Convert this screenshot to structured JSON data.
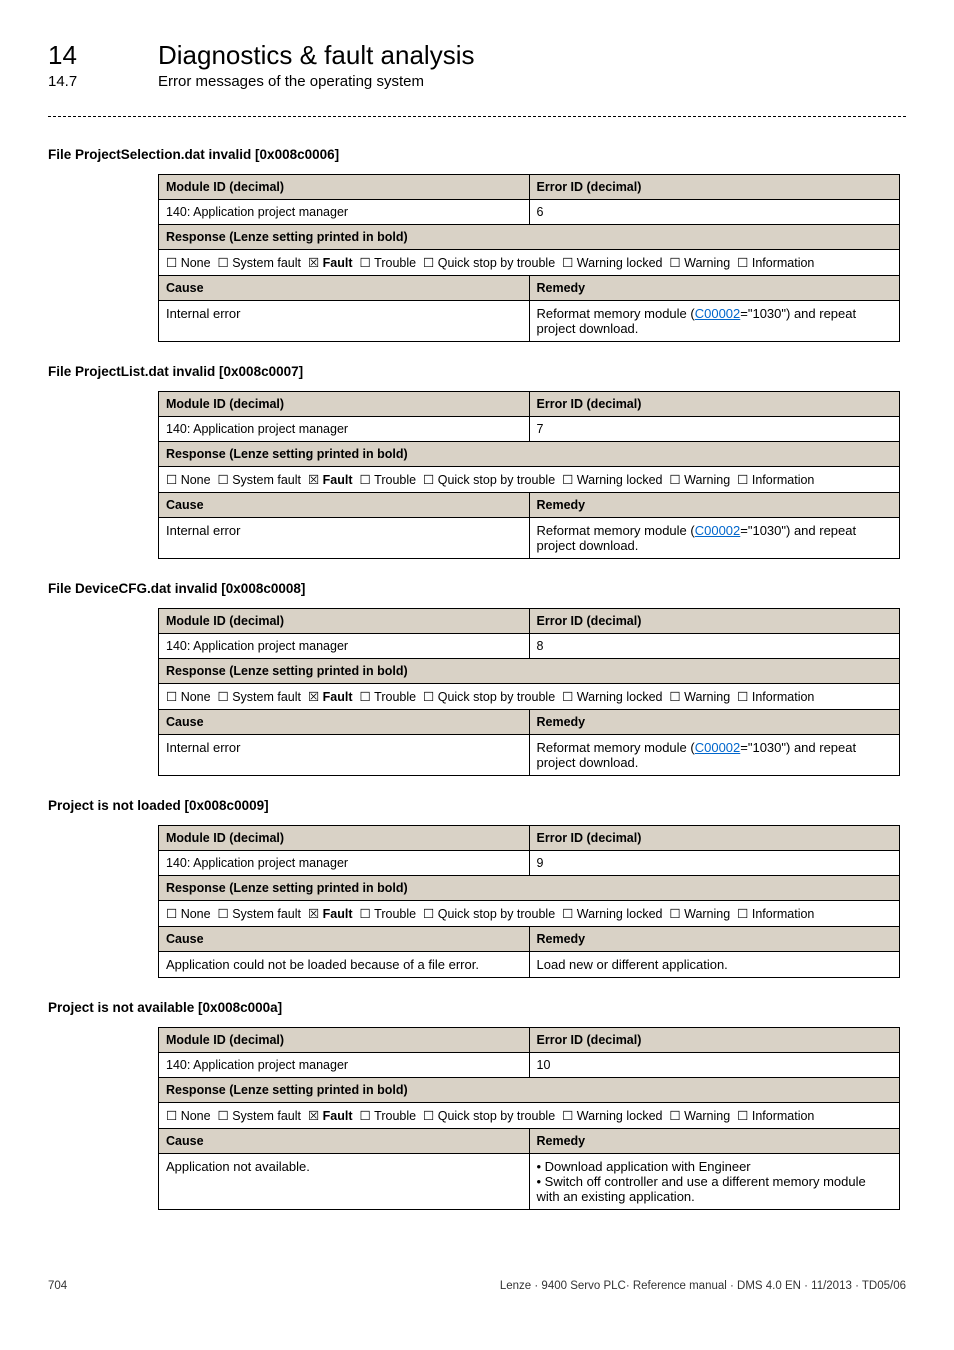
{
  "page": {
    "chapter_number": "14",
    "chapter_title": "Diagnostics & fault analysis",
    "section_number": "14.7",
    "section_title": "Error messages of the operating system",
    "footer_page": "704",
    "footer_info": "Lenze · 9400 Servo PLC· Reference manual · DMS 4.0 EN · 11/2013 · TD05/06"
  },
  "labels": {
    "module_id": "Module ID",
    "decimal_suffix": " (decimal)",
    "error_id": "Error ID",
    "response_label": "Response",
    "response_suffix": " (Lenze setting printed in bold)",
    "cause": "Cause",
    "remedy": "Remedy"
  },
  "response_row": {
    "none": "None",
    "system_fault": "System fault",
    "fault": "Fault",
    "trouble": "Trouble",
    "quick_stop": "Quick stop by trouble",
    "warning_locked": "Warning locked",
    "warning": "Warning",
    "information": "Information"
  },
  "glyphs": {
    "unchecked": "☐",
    "checked": "☒"
  },
  "errors": [
    {
      "title": "File ProjectSelection.dat invalid [0x008c0006]",
      "module": "140: Application project manager",
      "error_id": "6",
      "cause": "Internal error",
      "remedy_pre": "Reformat memory module (",
      "remedy_link": "C00002",
      "remedy_post": "=\"1030\") and repeat project download."
    },
    {
      "title": "File ProjectList.dat invalid [0x008c0007]",
      "module": "140: Application project manager",
      "error_id": "7",
      "cause": "Internal error",
      "remedy_pre": "Reformat memory module (",
      "remedy_link": "C00002",
      "remedy_post": "=\"1030\") and repeat project download."
    },
    {
      "title": "File DeviceCFG.dat invalid [0x008c0008]",
      "module": "140: Application project manager",
      "error_id": "8",
      "cause": "Internal error",
      "remedy_pre": "Reformat memory module (",
      "remedy_link": "C00002",
      "remedy_post": "=\"1030\") and repeat project download."
    },
    {
      "title": "Project is not loaded [0x008c0009]",
      "module": "140: Application project manager",
      "error_id": "9",
      "cause": "Application could not be loaded because of a file error.",
      "remedy_plain": "Load new or different application."
    },
    {
      "title": "Project is not available [0x008c000a]",
      "module": "140: Application project manager",
      "error_id": "10",
      "cause": "Application not available.",
      "remedy_bullets": [
        "Download application with Engineer",
        "Switch off controller and use a different memory module with an existing application."
      ]
    }
  ]
}
